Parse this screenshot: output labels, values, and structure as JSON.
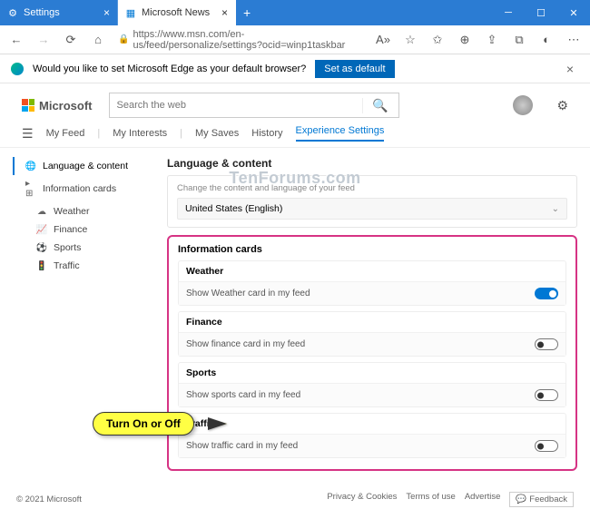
{
  "tabs": [
    {
      "label": "Settings",
      "icon": "⚙"
    },
    {
      "label": "Microsoft News",
      "icon": "▦"
    }
  ],
  "url": "https://www.msn.com/en-us/feed/personalize/settings?ocid=winp1taskbar",
  "infobar": {
    "msg": "Would you like to set Microsoft Edge as your default browser?",
    "btn": "Set as default"
  },
  "logo": "Microsoft",
  "search": {
    "placeholder": "Search the web"
  },
  "watermark": "TenForums.com",
  "nav": {
    "items": [
      "My Feed",
      "My Interests",
      "My Saves",
      "History",
      "Experience Settings"
    ],
    "active": "Experience Settings"
  },
  "side": [
    {
      "icon": "🌐",
      "label": "Language & content",
      "sel": true
    },
    {
      "icon": "▸ ⊞",
      "label": "Information cards"
    },
    {
      "icon": "☁",
      "label": "Weather",
      "sub": true
    },
    {
      "icon": "📈",
      "label": "Finance",
      "sub": true
    },
    {
      "icon": "⚽",
      "label": "Sports",
      "sub": true
    },
    {
      "icon": "🚦",
      "label": "Traffic",
      "sub": true
    }
  ],
  "lang": {
    "title": "Language & content",
    "sub": "Change the content and language of your feed",
    "value": "United States (English)"
  },
  "cards": {
    "title": "Information cards",
    "items": [
      {
        "h": "Weather",
        "b": "Show Weather card in my feed",
        "on": true
      },
      {
        "h": "Finance",
        "b": "Show finance card in my feed",
        "on": false
      },
      {
        "h": "Sports",
        "b": "Show sports card in my feed",
        "on": false
      },
      {
        "h": "Traffic",
        "b": "Show traffic card in my feed",
        "on": false
      }
    ]
  },
  "callout": "Turn On or Off",
  "footer": {
    "copy": "© 2021 Microsoft",
    "links": [
      "Privacy & Cookies",
      "Terms of use",
      "Advertise"
    ],
    "fb": "Feedback"
  }
}
